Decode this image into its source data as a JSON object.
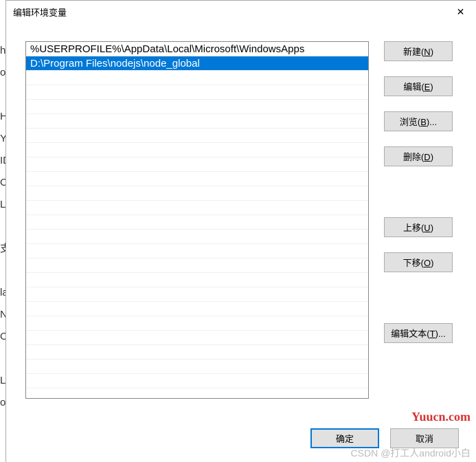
{
  "title": "编辑环境变量",
  "bgLetters": "h\no\n \nH\nY\nID\nO\nL\n \n支\n \nla\nN\nO\n \nLI\no",
  "entries": [
    {
      "text": "%USERPROFILE%\\AppData\\Local\\Microsoft\\WindowsApps",
      "selected": false
    },
    {
      "text": "D:\\Program Files\\nodejs\\node_global",
      "selected": true
    }
  ],
  "buttons": {
    "new": {
      "label": "新建(",
      "key": "N",
      "suffix": ")"
    },
    "edit": {
      "label": "编辑(",
      "key": "E",
      "suffix": ")"
    },
    "browse": {
      "label": "浏览(",
      "key": "B",
      "suffix": ")..."
    },
    "delete": {
      "label": "删除(",
      "key": "D",
      "suffix": ")"
    },
    "moveUp": {
      "label": "上移(",
      "key": "U",
      "suffix": ")"
    },
    "moveDown": {
      "label": "下移(",
      "key": "O",
      "suffix": ")"
    },
    "editText": {
      "label": "编辑文本(",
      "key": "T",
      "suffix": ")..."
    }
  },
  "footer": {
    "ok": "确定",
    "cancel": "取消"
  },
  "watermark1": "Yuucn.com",
  "watermark2": "CSDN @打工人android小白"
}
